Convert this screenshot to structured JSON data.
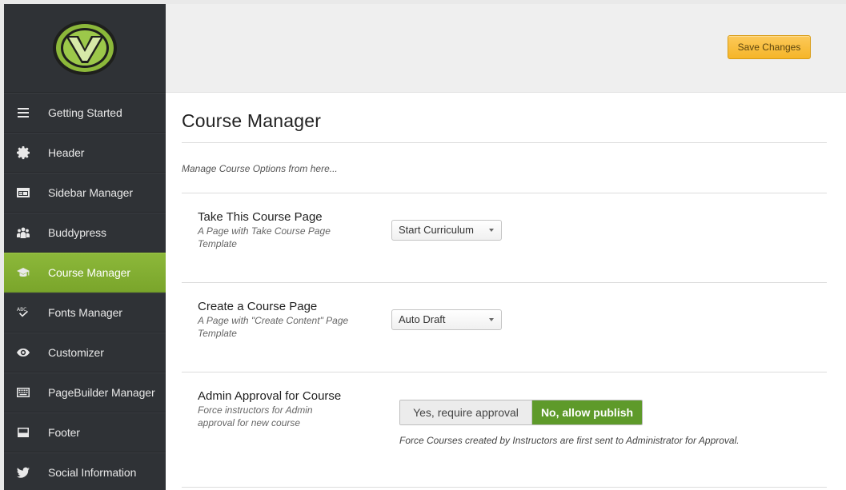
{
  "topbar": {
    "save_label": "Save Changes"
  },
  "sidebar": {
    "items": [
      {
        "label": "Getting Started",
        "icon": "menu-lines-icon"
      },
      {
        "label": "Header",
        "icon": "gear-icon"
      },
      {
        "label": "Sidebar Manager",
        "icon": "sidebar-layout-icon"
      },
      {
        "label": "Buddypress",
        "icon": "users-group-icon"
      },
      {
        "label": "Course Manager",
        "icon": "graduation-cap-icon",
        "active": true
      },
      {
        "label": "Fonts Manager",
        "icon": "abc-check-icon"
      },
      {
        "label": "Customizer",
        "icon": "eye-icon"
      },
      {
        "label": "PageBuilder Manager",
        "icon": "keyboard-icon"
      },
      {
        "label": "Footer",
        "icon": "footer-layout-icon"
      },
      {
        "label": "Social Information",
        "icon": "twitter-bird-icon"
      }
    ]
  },
  "main": {
    "title": "Course Manager",
    "description": "Manage Course Options from here...",
    "options": [
      {
        "title": "Take This Course Page",
        "subtitle": "A Page with Take Course Page Template",
        "value": "Start Curriculum"
      },
      {
        "title": "Create a Course Page",
        "subtitle": "A Page with \"Create Content\" Page Template",
        "value": "Auto Draft"
      },
      {
        "title": "Admin Approval for Course",
        "subtitle": "Force instructors for Admin approval for new course",
        "toggle_off": "Yes, require approval",
        "toggle_on": "No, allow publish",
        "note": "Force Courses created by Instructors are first sent to Administrator for Approval."
      }
    ]
  },
  "colors": {
    "sidebar_bg": "#2f3236",
    "active_item": "#7fae31",
    "save_button": "#f7bd3a",
    "toggle_on": "#5e9a2a"
  }
}
